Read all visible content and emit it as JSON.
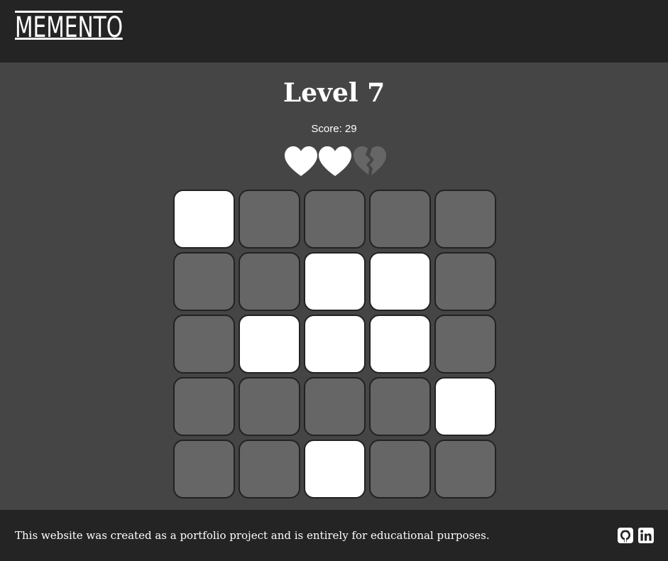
{
  "header": {
    "logo_text": "MEMENTO"
  },
  "game": {
    "level_label": "Level 7",
    "score_label": "Score: 29",
    "lives": {
      "total": 3,
      "remaining": 2
    },
    "grid": {
      "rows": 5,
      "cols": 5,
      "cells": [
        [
          1,
          0,
          0,
          0,
          0
        ],
        [
          0,
          0,
          1,
          1,
          0
        ],
        [
          0,
          1,
          1,
          1,
          0
        ],
        [
          0,
          0,
          0,
          0,
          1
        ],
        [
          0,
          0,
          1,
          0,
          0
        ]
      ]
    },
    "colors": {
      "lit_tile": "#ffffff",
      "unlit_tile": "#666666",
      "tile_border": "#222222",
      "heart_full": "#ffffff",
      "heart_broken": "#666666"
    }
  },
  "footer": {
    "text": "This website was created as a portfolio project and is entirely for educational purposes.",
    "icons": [
      "github-icon",
      "linkedin-icon"
    ]
  }
}
